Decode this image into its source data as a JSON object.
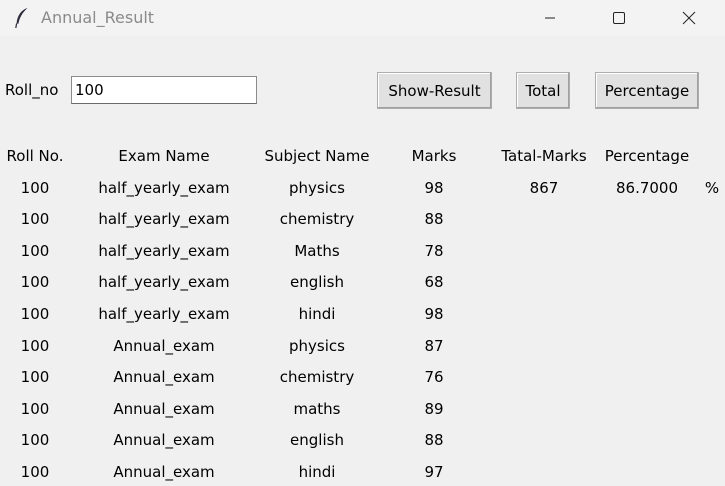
{
  "window": {
    "title": "Annual_Result",
    "icon": "feather-icon",
    "controls": [
      "minimize-icon",
      "maximize-icon",
      "close-icon"
    ]
  },
  "form": {
    "roll_label": "Roll_no",
    "roll_value": "100",
    "buttons": {
      "show_result": "Show-Result",
      "total": "Total",
      "percentage": "Percentage"
    }
  },
  "table": {
    "headers": {
      "roll": "Roll No.",
      "exam": "Exam Name",
      "subject": "Subject Name",
      "marks": "Marks",
      "total": "Tatal-Marks",
      "percentage": "Percentage"
    },
    "rows": [
      {
        "roll": "100",
        "exam": "half_yearly_exam",
        "subject": "physics",
        "marks": "98"
      },
      {
        "roll": "100",
        "exam": "half_yearly_exam",
        "subject": "chemistry",
        "marks": "88"
      },
      {
        "roll": "100",
        "exam": "half_yearly_exam",
        "subject": "Maths",
        "marks": "78"
      },
      {
        "roll": "100",
        "exam": "half_yearly_exam",
        "subject": "english",
        "marks": "68"
      },
      {
        "roll": "100",
        "exam": "half_yearly_exam",
        "subject": "hindi",
        "marks": "98"
      },
      {
        "roll": "100",
        "exam": "Annual_exam",
        "subject": "physics",
        "marks": "87"
      },
      {
        "roll": "100",
        "exam": "Annual_exam",
        "subject": "chemistry",
        "marks": "76"
      },
      {
        "roll": "100",
        "exam": "Annual_exam",
        "subject": "maths",
        "marks": "89"
      },
      {
        "roll": "100",
        "exam": "Annual_exam",
        "subject": "english",
        "marks": "88"
      },
      {
        "roll": "100",
        "exam": "Annual_exam",
        "subject": "hindi",
        "marks": "97"
      }
    ],
    "summary": {
      "total_marks": "867",
      "percentage": "86.7000",
      "percent_sign": "%"
    }
  },
  "colors": {
    "window_bg": "#f0f0f0",
    "titlebar_bg": "#f3f3f3",
    "title_text": "#8a8a8a",
    "button_bg": "#e1e1e1"
  }
}
